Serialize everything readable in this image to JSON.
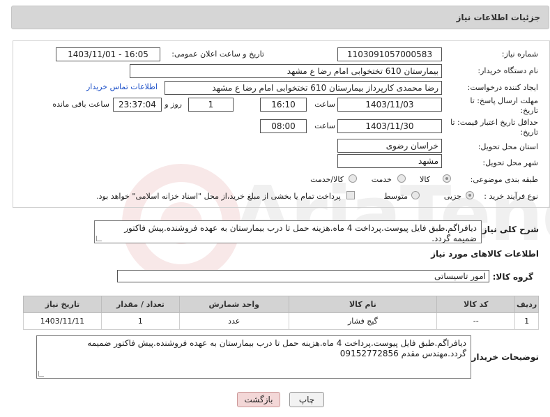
{
  "header": {
    "title": "جزئیات اطلاعات نیاز"
  },
  "watermark": {
    "text": "AriaTender.net"
  },
  "fields": {
    "need_number": {
      "label": "شماره نیاز:",
      "value": "1103091057000583"
    },
    "announce_datetime": {
      "label": "تاریخ و ساعت اعلان عمومی:",
      "value": "1403/11/01 - 16:05"
    },
    "buyer_org": {
      "label": "نام دستگاه خریدار:",
      "value": "بیمارستان 610 تختخوابی امام رضا ع  مشهد"
    },
    "requester": {
      "label": "ایجاد کننده درخواست:",
      "value": "رضا محمدی کارپرداز بیمارستان 610 تختخوابی امام رضا ع  مشهد",
      "contact_link": "اطلاعات تماس خریدار"
    },
    "reply_deadline": {
      "label": "مهلت ارسال پاسخ: تا تاریخ:",
      "date": "1403/11/03",
      "time_label": "ساعت",
      "time": "16:10",
      "days": "1",
      "days_label": "روز و",
      "remaining": "23:37:04",
      "remaining_label": "ساعت باقی مانده"
    },
    "price_validity": {
      "label": "حداقل تاریخ اعتبار قیمت: تا تاریخ:",
      "date": "1403/11/30",
      "time_label": "ساعت",
      "time": "08:00"
    },
    "province": {
      "label": "استان محل تحویل:",
      "value": "خراسان رضوی"
    },
    "city": {
      "label": "شهر محل تحویل:",
      "value": "مشهد"
    },
    "category": {
      "label": "طبقه بندی موضوعی:",
      "options": [
        "کالا",
        "خدمت",
        "کالا/خدمت"
      ],
      "selected": "کالا"
    },
    "purchase_type": {
      "label": "نوع فرآیند خرید :",
      "options": [
        "جزیی",
        "متوسط"
      ],
      "selected": "جزیی",
      "note": "پرداخت تمام یا بخشی از مبلغ خرید،از محل \"اسناد خزانه اسلامی\" خواهد بود."
    }
  },
  "description": {
    "label": "شرح کلی نیاز:",
    "value": "دیافراگم.طبق فایل پیوست.پرداخت 4 ماه.هزینه حمل تا درب بیمارستان به عهده فروشنده.پیش فاکتور ضمیمه گردد."
  },
  "goods_section": {
    "title": "اطلاعات کالاهای مورد نیاز",
    "group_label": "گروه کالا:",
    "group_value": "امور تاسیساتی"
  },
  "table": {
    "headers": [
      "ردیف",
      "کد کالا",
      "نام کالا",
      "واحد شمارش",
      "تعداد / مقدار",
      "تاریخ نیاز"
    ],
    "rows": [
      {
        "row": "1",
        "code": "--",
        "name": "گیج فشار",
        "unit": "عدد",
        "qty": "1",
        "date": "1403/11/11"
      }
    ]
  },
  "buyer_notes": {
    "label": "توضیحات خریدار:",
    "value": "دیافراگم.طبق فایل پیوست.پرداخت 4 ماه.هزینه حمل تا درب بیمارستان به عهده فروشنده.پیش فاکتور ضمیمه گردد.مهندس مقدم 09152772856"
  },
  "buttons": {
    "print": "چاپ",
    "back": "بازگشت"
  }
}
